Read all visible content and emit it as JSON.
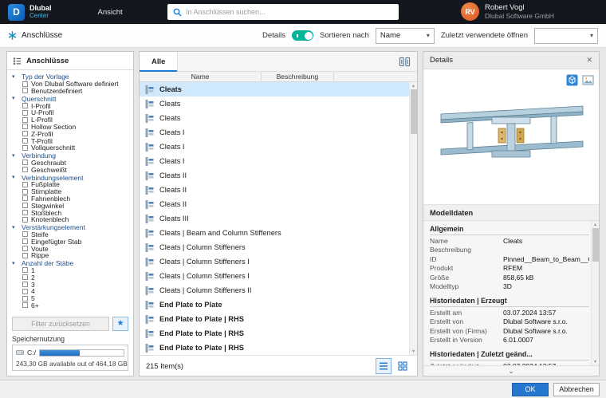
{
  "colors": {
    "accent_blue": "#1c7cd6",
    "toggle_on_teal": "#00b39b",
    "selected_row": "#cfe8fb",
    "titlebar_bg": "#14171d",
    "avatar_orange": "#d9541e"
  },
  "icons": {
    "logo_glyph": "D",
    "close": "✕",
    "dropdown_arrow": "▾",
    "tree_arrow": "▾",
    "star": "★",
    "chevron_down": "⌄",
    "scroll_up": "▲",
    "scroll_down": "▼"
  },
  "titlebar": {
    "app_name": "Dlubal",
    "app_sub": "Center",
    "menu": "Ansicht",
    "search_placeholder": "In Anschlüssen suchen...",
    "user_initials": "RV",
    "user_name": "Robert Vogl",
    "user_company": "Dlubal Software GmbH"
  },
  "toolbar": {
    "tab_label": "Anschlüsse",
    "details_label": "Details",
    "sort_label": "Sortieren nach",
    "sort_value": "Name",
    "recent_label": "Zuletzt verwendete öffnen",
    "recent_value": ""
  },
  "sidebar": {
    "title": "Anschlüsse",
    "tree": [
      {
        "group": true,
        "label": "Typ der Vorlage"
      },
      {
        "label": "Von Dlubal Software definiert"
      },
      {
        "label": "Benutzerdefiniert"
      },
      {
        "group": true,
        "label": "Querschnitt"
      },
      {
        "label": "I-Profil"
      },
      {
        "label": "U-Profil"
      },
      {
        "label": "L-Profil"
      },
      {
        "label": "Hollow Section"
      },
      {
        "label": "Z-Profil"
      },
      {
        "label": "T-Profil"
      },
      {
        "label": "Vollquerschnitt"
      },
      {
        "group": true,
        "label": "Verbindung"
      },
      {
        "label": "Geschraubt"
      },
      {
        "label": "Geschweißt"
      },
      {
        "group": true,
        "label": "Verbindungselement"
      },
      {
        "label": "Fußplatte"
      },
      {
        "label": "Stirnplatte"
      },
      {
        "label": "Fahnenblech"
      },
      {
        "label": "Stegwinkel"
      },
      {
        "label": "Stoßblech"
      },
      {
        "label": "Knotenblech"
      },
      {
        "group": true,
        "label": "Verstärkungselement"
      },
      {
        "label": "Steife"
      },
      {
        "label": "Eingefügter Stab"
      },
      {
        "label": "Voute"
      },
      {
        "label": "Rippe"
      },
      {
        "group": true,
        "label": "Anzahl der Stäbe"
      },
      {
        "label": "1"
      },
      {
        "label": "2"
      },
      {
        "label": "3"
      },
      {
        "label": "4"
      },
      {
        "label": "5"
      },
      {
        "label": "6+"
      }
    ],
    "reset_filter": "Filter zurücksetzen",
    "storage_title": "Speichernutzung",
    "drive": "C:/",
    "storage_text": "243,30 GB available out of 464,18 GB"
  },
  "list": {
    "tab": "Alle",
    "columns": [
      "Name",
      "Beschreibung"
    ],
    "rows": [
      {
        "name": "Cleats",
        "selected": true
      },
      {
        "name": "Cleats"
      },
      {
        "name": "Cleats"
      },
      {
        "name": "Cleats I"
      },
      {
        "name": "Cleats I"
      },
      {
        "name": "Cleats I"
      },
      {
        "name": "Cleats II"
      },
      {
        "name": "Cleats II"
      },
      {
        "name": "Cleats II"
      },
      {
        "name": "Cleats III"
      },
      {
        "name": "Cleats | Beam and Column Stiffeners"
      },
      {
        "name": "Cleats | Column Stiffeners"
      },
      {
        "name": "Cleats | Column Stiffeners I"
      },
      {
        "name": "Cleats | Column Stiffeners I"
      },
      {
        "name": "Cleats | Column Stiffeners II"
      },
      {
        "name": "End Plate to Plate",
        "bold": true
      },
      {
        "name": "End Plate to Plate | RHS",
        "bold": true
      },
      {
        "name": "End Plate to Plate | RHS",
        "bold": true
      },
      {
        "name": "End Plate to Plate | RHS",
        "bold": true
      }
    ],
    "count": "215 Item(s)"
  },
  "details": {
    "title": "Details",
    "modeldata_title": "Modelldaten",
    "sections": [
      {
        "title": "Allgemein",
        "rows": [
          {
            "label": "Name",
            "value": "Cleats"
          },
          {
            "label": "Beschreibung",
            "value": ""
          },
          {
            "label": "ID",
            "value": "Pinned__Beam_to_Beam__Cleats"
          },
          {
            "label": "Produkt",
            "value": "RFEM"
          },
          {
            "label": "Größe",
            "value": "858,65 kB"
          },
          {
            "label": "Modelltyp",
            "value": "3D"
          }
        ]
      },
      {
        "title": "Historiedaten | Erzeugt",
        "rows": [
          {
            "label": "Erstellt am",
            "value": "03.07.2024 13:57"
          },
          {
            "label": "Erstellt von",
            "value": "Dlubal Software s.r.o."
          },
          {
            "label": "Erstellt von (Firma)",
            "value": "Dlubal Software s.r.o."
          },
          {
            "label": "Erstellt in Version",
            "value": "6.01.0007"
          }
        ]
      },
      {
        "title": "Historiedaten | Zuletzt geänd...",
        "rows": [
          {
            "label": "Zuletzt geändert",
            "value": "03.07.2024 13:57"
          }
        ]
      }
    ]
  },
  "footer": {
    "ok": "OK",
    "cancel": "Abbrechen"
  }
}
